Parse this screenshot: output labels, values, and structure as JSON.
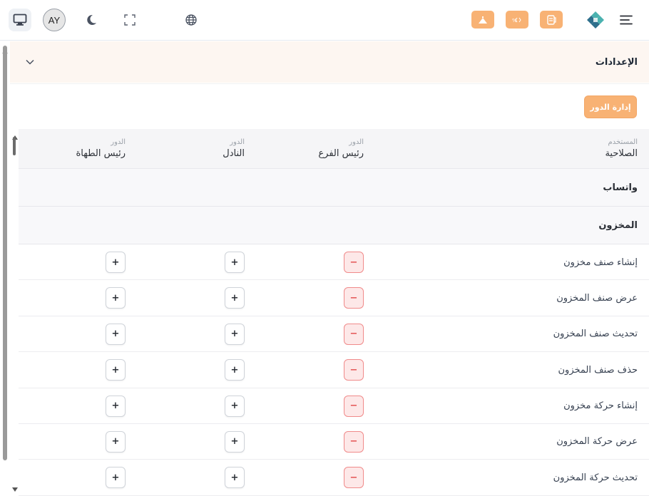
{
  "topbar": {
    "avatar_initials": "AY",
    "icons": [
      "monitor-icon",
      "moon-icon",
      "fullscreen-icon",
      "globe-icon",
      "home-icon",
      "code-icon",
      "document-icon",
      "logo-icon",
      "menu-icon"
    ]
  },
  "settings": {
    "title": "الإعدادات"
  },
  "manage_roles_button": "إدارة الدور",
  "table": {
    "header": {
      "permission_sub": "المستخدم",
      "permission_main": "الصلاحية",
      "columns": [
        {
          "sub": "الدور",
          "main": "رئيس الفرع"
        },
        {
          "sub": "الدور",
          "main": "النادل"
        },
        {
          "sub": "الدور",
          "main": "رئيس الطهاة"
        }
      ]
    },
    "groups": [
      {
        "label": "واتساب"
      },
      {
        "label": "المخزون"
      }
    ],
    "rows": [
      {
        "label": "إنشاء صنف مخزون",
        "c1": "−",
        "c2": "+",
        "c3": "+"
      },
      {
        "label": "عرض صنف المخزون",
        "c1": "−",
        "c2": "+",
        "c3": "+"
      },
      {
        "label": "تحديث صنف المخزون",
        "c1": "−",
        "c2": "+",
        "c3": "+"
      },
      {
        "label": "حذف صنف المخزون",
        "c1": "−",
        "c2": "+",
        "c3": "+"
      },
      {
        "label": "إنشاء حركة مخزون",
        "c1": "−",
        "c2": "+",
        "c3": "+"
      },
      {
        "label": "عرض حركة المخزون",
        "c1": "−",
        "c2": "+",
        "c3": "+"
      },
      {
        "label": "تحديث حركة المخزون",
        "c1": "−",
        "c2": "+",
        "c3": "+"
      }
    ]
  },
  "colors": {
    "accent": "#f8b274",
    "minus_bg": "#fde8e8",
    "minus_border": "#f08a8a",
    "header_bg": "#fdf6f1"
  }
}
